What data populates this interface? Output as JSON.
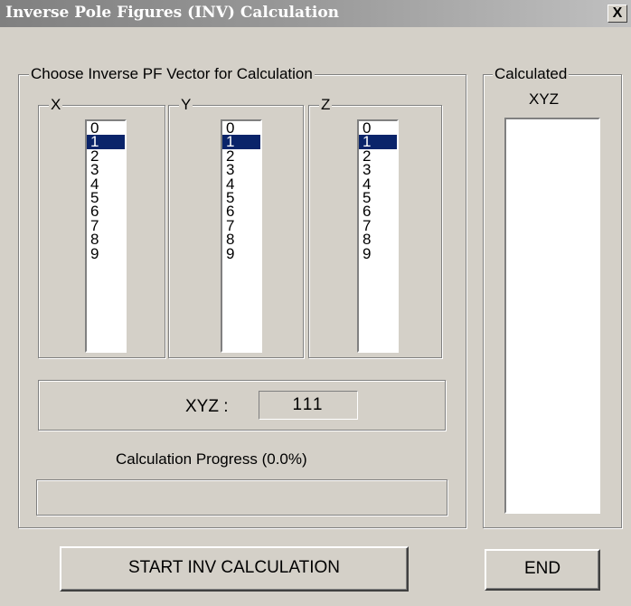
{
  "window": {
    "title": "Inverse Pole Figures (INV) Calculation",
    "close_label": "X"
  },
  "vector_group": {
    "legend": "Choose Inverse PF  Vector for Calculation",
    "x": {
      "legend": "X",
      "items": [
        "0",
        "1",
        "2",
        "3",
        "4",
        "5",
        "6",
        "7",
        "8",
        "9"
      ],
      "selected": "1"
    },
    "y": {
      "legend": "Y",
      "items": [
        "0",
        "1",
        "2",
        "3",
        "4",
        "5",
        "6",
        "7",
        "8",
        "9"
      ],
      "selected": "1"
    },
    "z": {
      "legend": "Z",
      "items": [
        "0",
        "1",
        "2",
        "3",
        "4",
        "5",
        "6",
        "7",
        "8",
        "9"
      ],
      "selected": "1"
    }
  },
  "xyz_display": {
    "label": "XYZ :",
    "value": "111"
  },
  "progress": {
    "label": "Calculation Progress  (0.0%)",
    "percent": 0.0
  },
  "calculated_group": {
    "legend": "Calculated",
    "subtitle": "XYZ"
  },
  "buttons": {
    "start": "START INV CALCULATION",
    "end": "END"
  }
}
